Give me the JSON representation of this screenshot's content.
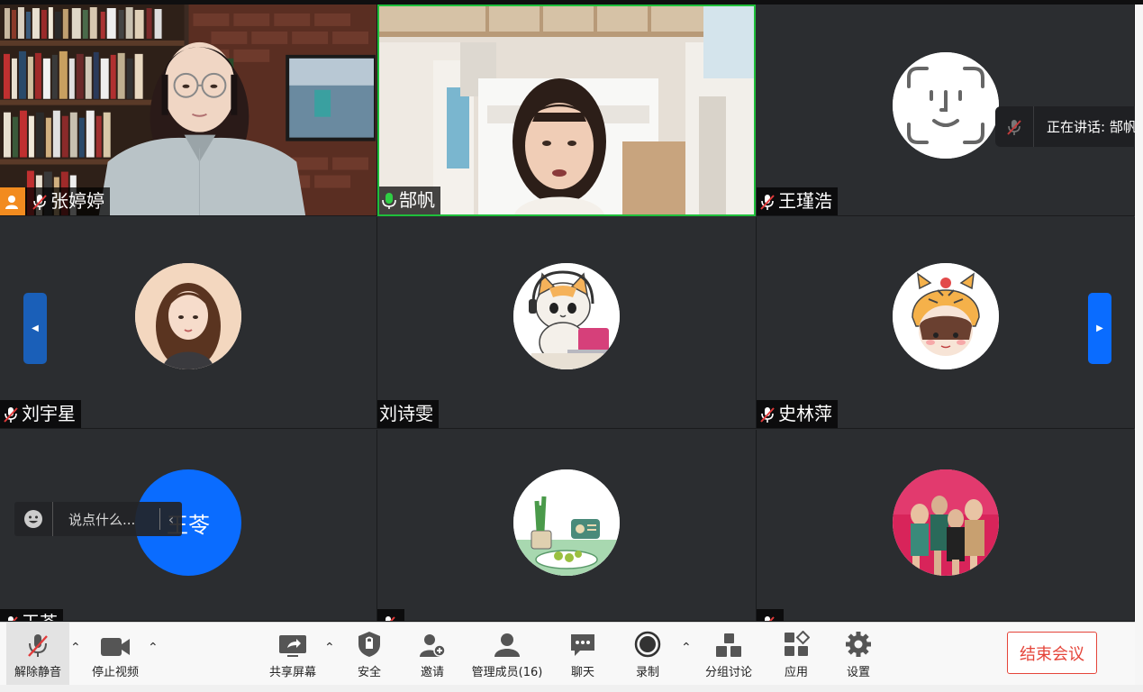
{
  "participants": [
    {
      "name": "张婷婷",
      "muted": true,
      "host": true
    },
    {
      "name": "郜帆",
      "muted": false,
      "active": true
    },
    {
      "name": "王瑾浩",
      "muted": true
    },
    {
      "name": "刘宇星",
      "muted": true
    },
    {
      "name": "刘诗雯",
      "muted": false
    },
    {
      "name": "史林萍",
      "muted": true
    },
    {
      "name": "王苓",
      "muted": true
    },
    {
      "name": "",
      "muted": true
    },
    {
      "name": "",
      "muted": true
    }
  ],
  "speaking": {
    "label": "正在讲话: 郜帆;"
  },
  "chat": {
    "placeholder": "说点什么..."
  },
  "avatar_text": {
    "wang_ling": "王苓"
  },
  "toolbar": {
    "unmute": "解除静音",
    "stop_video": "停止视频",
    "share_screen": "共享屏幕",
    "security": "安全",
    "invite": "邀请",
    "manage_members": "管理成员(16)",
    "chat": "聊天",
    "record": "录制",
    "breakout": "分组讨论",
    "apps": "应用",
    "settings": "设置",
    "end_meeting": "结束会议"
  },
  "colors": {
    "accent": "#0a6cff",
    "active_border": "#1fbf3b",
    "end_red": "#e5453a",
    "host_orange": "#f28b1f"
  },
  "icons": [
    "user-icon",
    "mic-off-icon",
    "mic-on-icon",
    "face-id-icon",
    "chevron-left-icon",
    "chevron-right-icon",
    "emoji-icon",
    "video-camera-icon",
    "share-screen-icon",
    "shield-icon",
    "add-person-icon",
    "people-icon",
    "chat-bubble-icon",
    "record-icon",
    "breakout-icon",
    "apps-icon",
    "gear-icon"
  ]
}
